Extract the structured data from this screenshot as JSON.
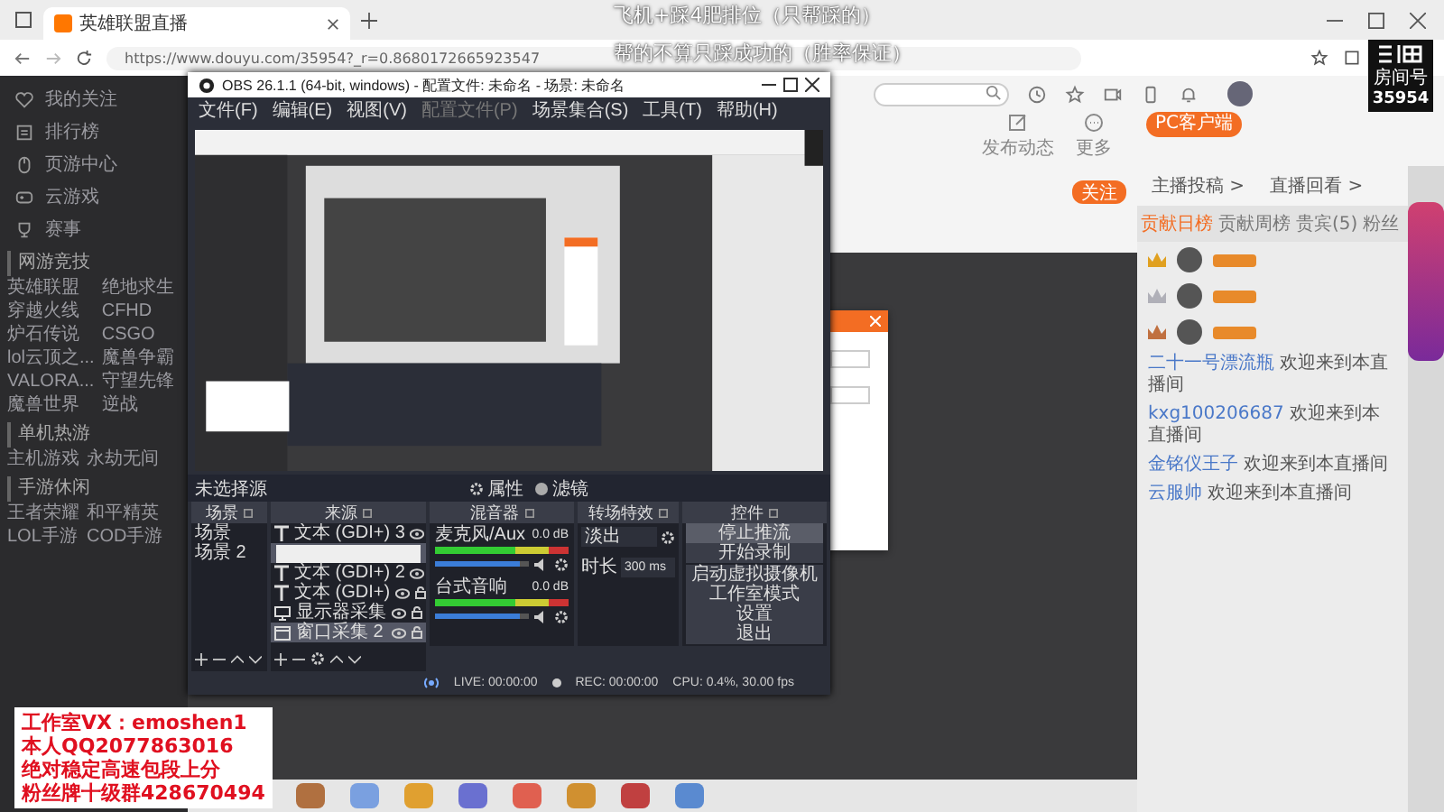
{
  "browser": {
    "tab_title": "英雄联盟直播",
    "url": "https://www.douyu.com/35954?_r=0.8680172665923547"
  },
  "stream_overlay": {
    "headline": [
      "飞机+踩4肥排位（只帮踩的）",
      "帮的不算只踩成功的（胜率保证）"
    ],
    "contact": [
      "工作室VX：emoshen1",
      "本人QQ2077863016",
      "绝对稳定高速包段上分",
      "粉丝牌十级群428670494"
    ]
  },
  "room_badge": {
    "label": "房间号",
    "number": "35954"
  },
  "sidebar": {
    "items": [
      {
        "label": "我的关注"
      },
      {
        "label": "排行榜"
      },
      {
        "label": "页游中心"
      },
      {
        "label": "云游戏"
      },
      {
        "label": "赛事"
      }
    ],
    "sections": [
      {
        "title": "网游竞技",
        "items": [
          "英雄联盟",
          "绝地求生",
          "穿越火线",
          "CFHD",
          "炉石传说",
          "CSGO",
          "lol云顶之...",
          "魔兽争霸",
          "VALORA...",
          "守望先锋",
          "魔兽世界",
          "逆战"
        ]
      },
      {
        "title": "单机热游",
        "items": [
          "主机游戏",
          "永劫无间"
        ]
      },
      {
        "title": "手游休闲",
        "items": [
          "王者荣耀",
          "和平精英",
          "LOL手游",
          "COD手游"
        ]
      }
    ]
  },
  "header": {
    "actions": [
      {
        "label": "发布动态"
      },
      {
        "label": "更多"
      }
    ],
    "client_button": "PC客户端"
  },
  "room": {
    "follow_button": "关注"
  },
  "chat": {
    "links": [
      "主播投稿 >",
      "直播回看 >"
    ],
    "tabs": [
      {
        "label": "贡献日榜",
        "selected": true
      },
      {
        "label": "贡献周榜",
        "selected": false
      },
      {
        "label": "贵宾(5)",
        "selected": false
      },
      {
        "label": "粉丝",
        "selected": false
      }
    ],
    "messages": [
      {
        "user": "二十一号漂流瓶",
        "text": "欢迎来到本直播间"
      },
      {
        "user": "kxg100206687",
        "text": "欢迎来到本直播间"
      },
      {
        "user": "金铭仪王子",
        "text": "欢迎来到本直播间"
      },
      {
        "user": "云服帅",
        "text": "欢迎来到本直播间"
      }
    ]
  },
  "obs": {
    "title": "OBS 26.1.1 (64-bit, windows) - 配置文件: 未命名 - 场景: 未命名",
    "menu": [
      {
        "label": "文件(F)",
        "disabled": false
      },
      {
        "label": "编辑(E)",
        "disabled": false
      },
      {
        "label": "视图(V)",
        "disabled": false
      },
      {
        "label": "配置文件(P)",
        "disabled": true
      },
      {
        "label": "场景集合(S)",
        "disabled": false
      },
      {
        "label": "工具(T)",
        "disabled": false
      },
      {
        "label": "帮助(H)",
        "disabled": false
      }
    ],
    "no_source": "未选择源",
    "properties": "属性",
    "filters": "滤镜",
    "docks": [
      "场景",
      "来源",
      "混音器",
      "转场特效",
      "控件"
    ],
    "scenes": [
      {
        "name": "场景",
        "selected": false
      },
      {
        "name": "场景 2",
        "selected": false
      }
    ],
    "sources": [
      {
        "kind": "text",
        "name": "文本 (GDI+) 3",
        "selected": false
      },
      {
        "kind": "rename",
        "selected": true
      },
      {
        "kind": "text",
        "name": "文本 (GDI+) 2",
        "selected": false
      },
      {
        "kind": "text",
        "name": "文本 (GDI+)",
        "selected": false
      },
      {
        "kind": "display",
        "name": "显示器采集",
        "selected": false
      },
      {
        "kind": "window",
        "name": "窗口采集 2",
        "selected": true
      }
    ],
    "mixer": [
      {
        "name": "麦克风/Aux",
        "reading": "0.0 dB",
        "level": 0.9
      },
      {
        "name": "台式音响",
        "reading": "0.0 dB",
        "level": 0.9
      }
    ],
    "transition": {
      "value": "淡出",
      "duration_label": "时长",
      "duration": "300 ms"
    },
    "controls": [
      {
        "label": "停止推流",
        "active": true
      },
      {
        "label": "开始录制",
        "active": false
      },
      {
        "label": "启动虚拟摄像机",
        "active": false
      },
      {
        "label": "工作室模式",
        "active": false
      },
      {
        "label": "设置",
        "active": false
      },
      {
        "label": "退出",
        "active": false
      }
    ],
    "status": {
      "live": "LIVE: 00:00:00",
      "rec": "REC: 00:00:00",
      "cpu": "CPU: 0.4%, 30.00 fps"
    }
  }
}
